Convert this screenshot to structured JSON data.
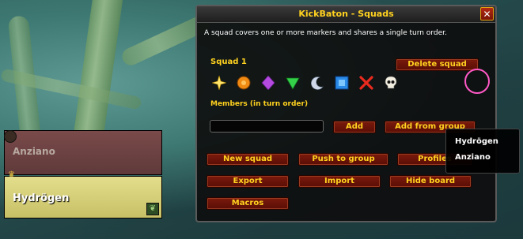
{
  "window": {
    "title": "KickBaton - Squads",
    "close_label": "✕",
    "description": "A squad covers one or more markers and shares a single turn order."
  },
  "squad": {
    "label": "Squad 1",
    "delete_label": "Delete squad",
    "markers": [
      "star-marker-icon",
      "circle-marker-icon",
      "diamond-marker-icon",
      "triangle-marker-icon",
      "moon-marker-icon",
      "square-marker-icon",
      "cross-marker-icon",
      "skull-marker-icon"
    ],
    "members_label": "Members (in turn order)",
    "member_input_value": "",
    "add_label": "Add",
    "add_from_group_label": "Add from group"
  },
  "actions": {
    "new_squad": "New squad",
    "push_to_group": "Push to group",
    "profiles": "Profiles",
    "export": "Export",
    "import": "Import",
    "hide_board": "Hide board",
    "macros": "Macros"
  },
  "dropdown": {
    "items": [
      "Hydrögen",
      "Anziano"
    ]
  },
  "party": {
    "members": [
      {
        "name": "Anziano"
      },
      {
        "name": "Hydrögen"
      }
    ]
  },
  "colors": {
    "title_gold": "#ffd21f",
    "button_red": "#7a1a0c",
    "cursor_pink": "#ff59c8"
  }
}
